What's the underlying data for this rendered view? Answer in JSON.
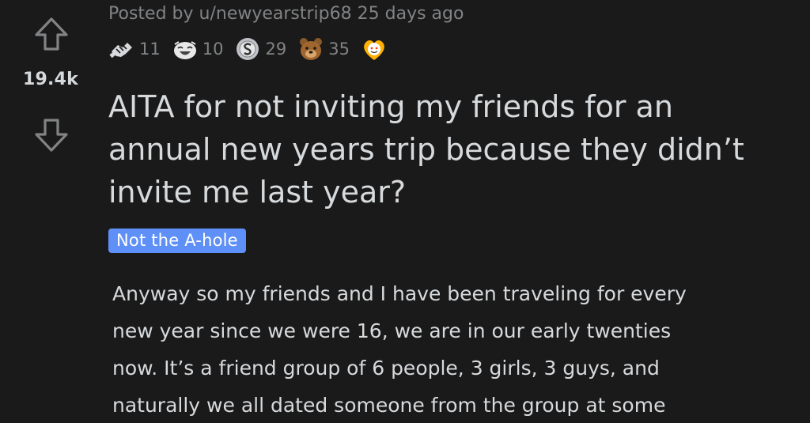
{
  "post": {
    "score": "19.4k",
    "posted_by_prefix": "Posted by",
    "username": "u/newyearstrip68",
    "age": "25 days ago",
    "awards": [
      {
        "icon": "handshake-award-icon",
        "count": "11"
      },
      {
        "icon": "laughing-award-icon",
        "count": "10"
      },
      {
        "icon": "silver-coin-award-icon",
        "count": "29"
      },
      {
        "icon": "bear-award-icon",
        "count": "35"
      },
      {
        "icon": "wholesome-award-icon",
        "count": ""
      }
    ],
    "title_lines": [
      "AITA for not inviting my friends for an",
      "annual new years trip because they didn’t",
      "invite me last year?"
    ],
    "flair": "Not the A-hole",
    "body_lines": [
      "Anyway so my friends and I have been traveling for every",
      "new year since we were 16, we are in our early twenties",
      "now. It’s a friend group of 6 people, 3 girls, 3 guys, and",
      "naturally we all dated someone from the group at some"
    ]
  },
  "colors": {
    "background": "#1a1a1b",
    "text": "#d7dadc",
    "meta": "#818384",
    "flair": "#5f90f7"
  }
}
